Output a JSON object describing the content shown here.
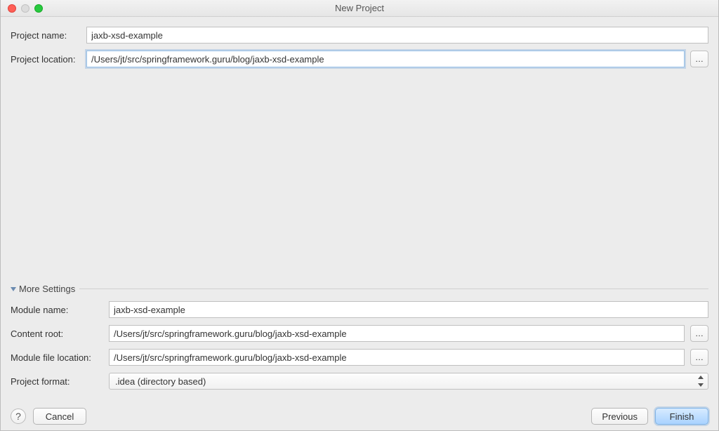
{
  "window": {
    "title": "New Project"
  },
  "top": {
    "project_name_label": "Project name:",
    "project_name": "jaxb-xsd-example",
    "project_location_label": "Project location:",
    "project_location": "/Users/jt/src/springframework.guru/blog/jaxb-xsd-example",
    "browse_ellipsis": "…"
  },
  "more": {
    "header": "More Settings",
    "module_name_label": "Module name:",
    "module_name": "jaxb-xsd-example",
    "content_root_label": "Content root:",
    "content_root": "/Users/jt/src/springframework.guru/blog/jaxb-xsd-example",
    "module_file_location_label": "Module file location:",
    "module_file_location": "/Users/jt/src/springframework.guru/blog/jaxb-xsd-example",
    "project_format_label": "Project format:",
    "project_format": ".idea (directory based)"
  },
  "footer": {
    "help": "?",
    "cancel": "Cancel",
    "previous": "Previous",
    "finish": "Finish"
  }
}
